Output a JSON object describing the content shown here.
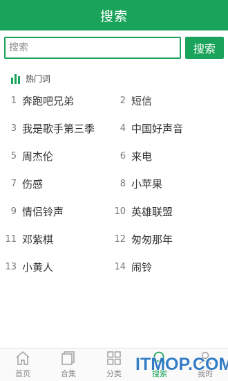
{
  "header": {
    "title": "搜索"
  },
  "search": {
    "placeholder": "搜索",
    "value": "",
    "button_label": "搜索"
  },
  "hot": {
    "title": "热门词",
    "items": [
      {
        "num": "1",
        "word": "奔跑吧兄弟"
      },
      {
        "num": "2",
        "word": "短信"
      },
      {
        "num": "3",
        "word": "我是歌手第三季"
      },
      {
        "num": "4",
        "word": "中国好声音"
      },
      {
        "num": "5",
        "word": "周杰伦"
      },
      {
        "num": "6",
        "word": "来电"
      },
      {
        "num": "7",
        "word": "伤感"
      },
      {
        "num": "8",
        "word": "小苹果"
      },
      {
        "num": "9",
        "word": "情侣铃声"
      },
      {
        "num": "10",
        "word": "英雄联盟"
      },
      {
        "num": "11",
        "word": "邓紫棋"
      },
      {
        "num": "12",
        "word": "匆匆那年"
      },
      {
        "num": "13",
        "word": "小黄人"
      },
      {
        "num": "14",
        "word": "闹铃"
      }
    ]
  },
  "nav": {
    "items": [
      {
        "label": "首页",
        "icon": "home-icon",
        "active": false
      },
      {
        "label": "合集",
        "icon": "collection-icon",
        "active": false
      },
      {
        "label": "分类",
        "icon": "category-icon",
        "active": false
      },
      {
        "label": "搜索",
        "icon": "search-icon",
        "active": true
      },
      {
        "label": "我的",
        "icon": "user-icon",
        "active": false
      }
    ]
  },
  "watermark": {
    "text": "ITMOP.COM"
  },
  "colors": {
    "accent": "#1aa35a",
    "watermark": "#1f6fbf"
  }
}
